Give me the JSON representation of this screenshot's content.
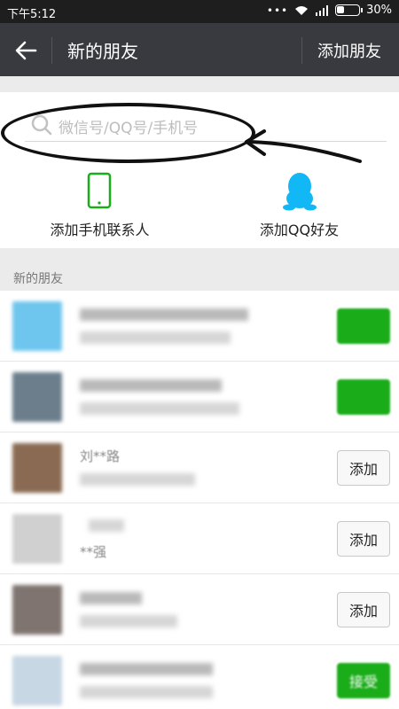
{
  "status": {
    "time": "下午5:12",
    "dots": "•••",
    "battery": "30%"
  },
  "header": {
    "title": "新的朋友",
    "action": "添加朋友"
  },
  "search": {
    "placeholder": "微信号/QQ号/手机号"
  },
  "quick_actions": [
    {
      "label": "添加手机联系人",
      "icon": "phone-icon",
      "color": "#1aad19"
    },
    {
      "label": "添加QQ好友",
      "icon": "qq-penguin-icon",
      "color": "#12b7f5"
    }
  ],
  "section_title": "新的朋友",
  "contacts": [
    {
      "name": "",
      "button": "",
      "button_style": "green"
    },
    {
      "name": "",
      "button": "",
      "button_style": "green"
    },
    {
      "name": "刘**路",
      "button": "添加",
      "button_style": "add"
    },
    {
      "name": "**强",
      "button": "添加",
      "button_style": "add"
    },
    {
      "name": "",
      "button": "添加",
      "button_style": "add"
    },
    {
      "name": "",
      "button": "接受",
      "button_style": "green"
    }
  ],
  "colors": {
    "titlebar": "#393a3f",
    "wechat_green": "#1aad19"
  }
}
